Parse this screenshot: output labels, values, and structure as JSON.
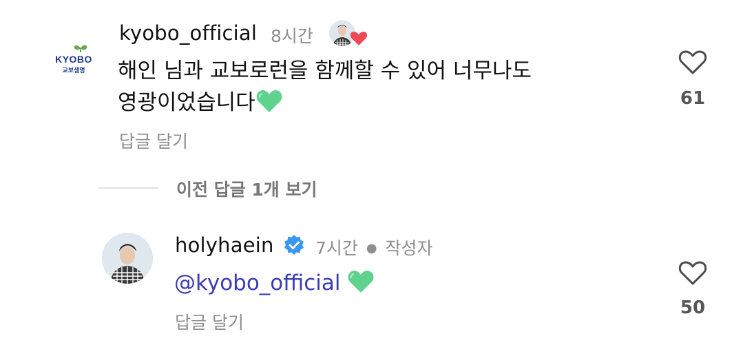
{
  "comments": [
    {
      "username": "kyobo_official",
      "time": "8시간",
      "text_line1": "해인 님과 교보로런을 함께할 수 있어 너무나도",
      "text_line2": "영광이었습니다",
      "reply_label": "답글 달기",
      "likes": "61",
      "avatar_logo_text": "KYOBO",
      "avatar_logo_subtext": "교보생명",
      "author_liked": true
    },
    {
      "username": "holyhaein",
      "verified": true,
      "time": "7시간",
      "author_tag": "작성자",
      "mention": "@kyobo_official",
      "reply_label": "답글 달기",
      "likes": "50"
    }
  ],
  "thread": {
    "view_replies_label": "이전 답글 1개 보기"
  },
  "colors": {
    "muted": "#8e8e8e",
    "mention": "#3b3bb3",
    "verified": "#3897f0",
    "like_heart": "#ed4956",
    "green_heart": "#5fd38d",
    "kyobo_blue": "#1f3c88",
    "kyobo_green": "#6aa84f"
  }
}
